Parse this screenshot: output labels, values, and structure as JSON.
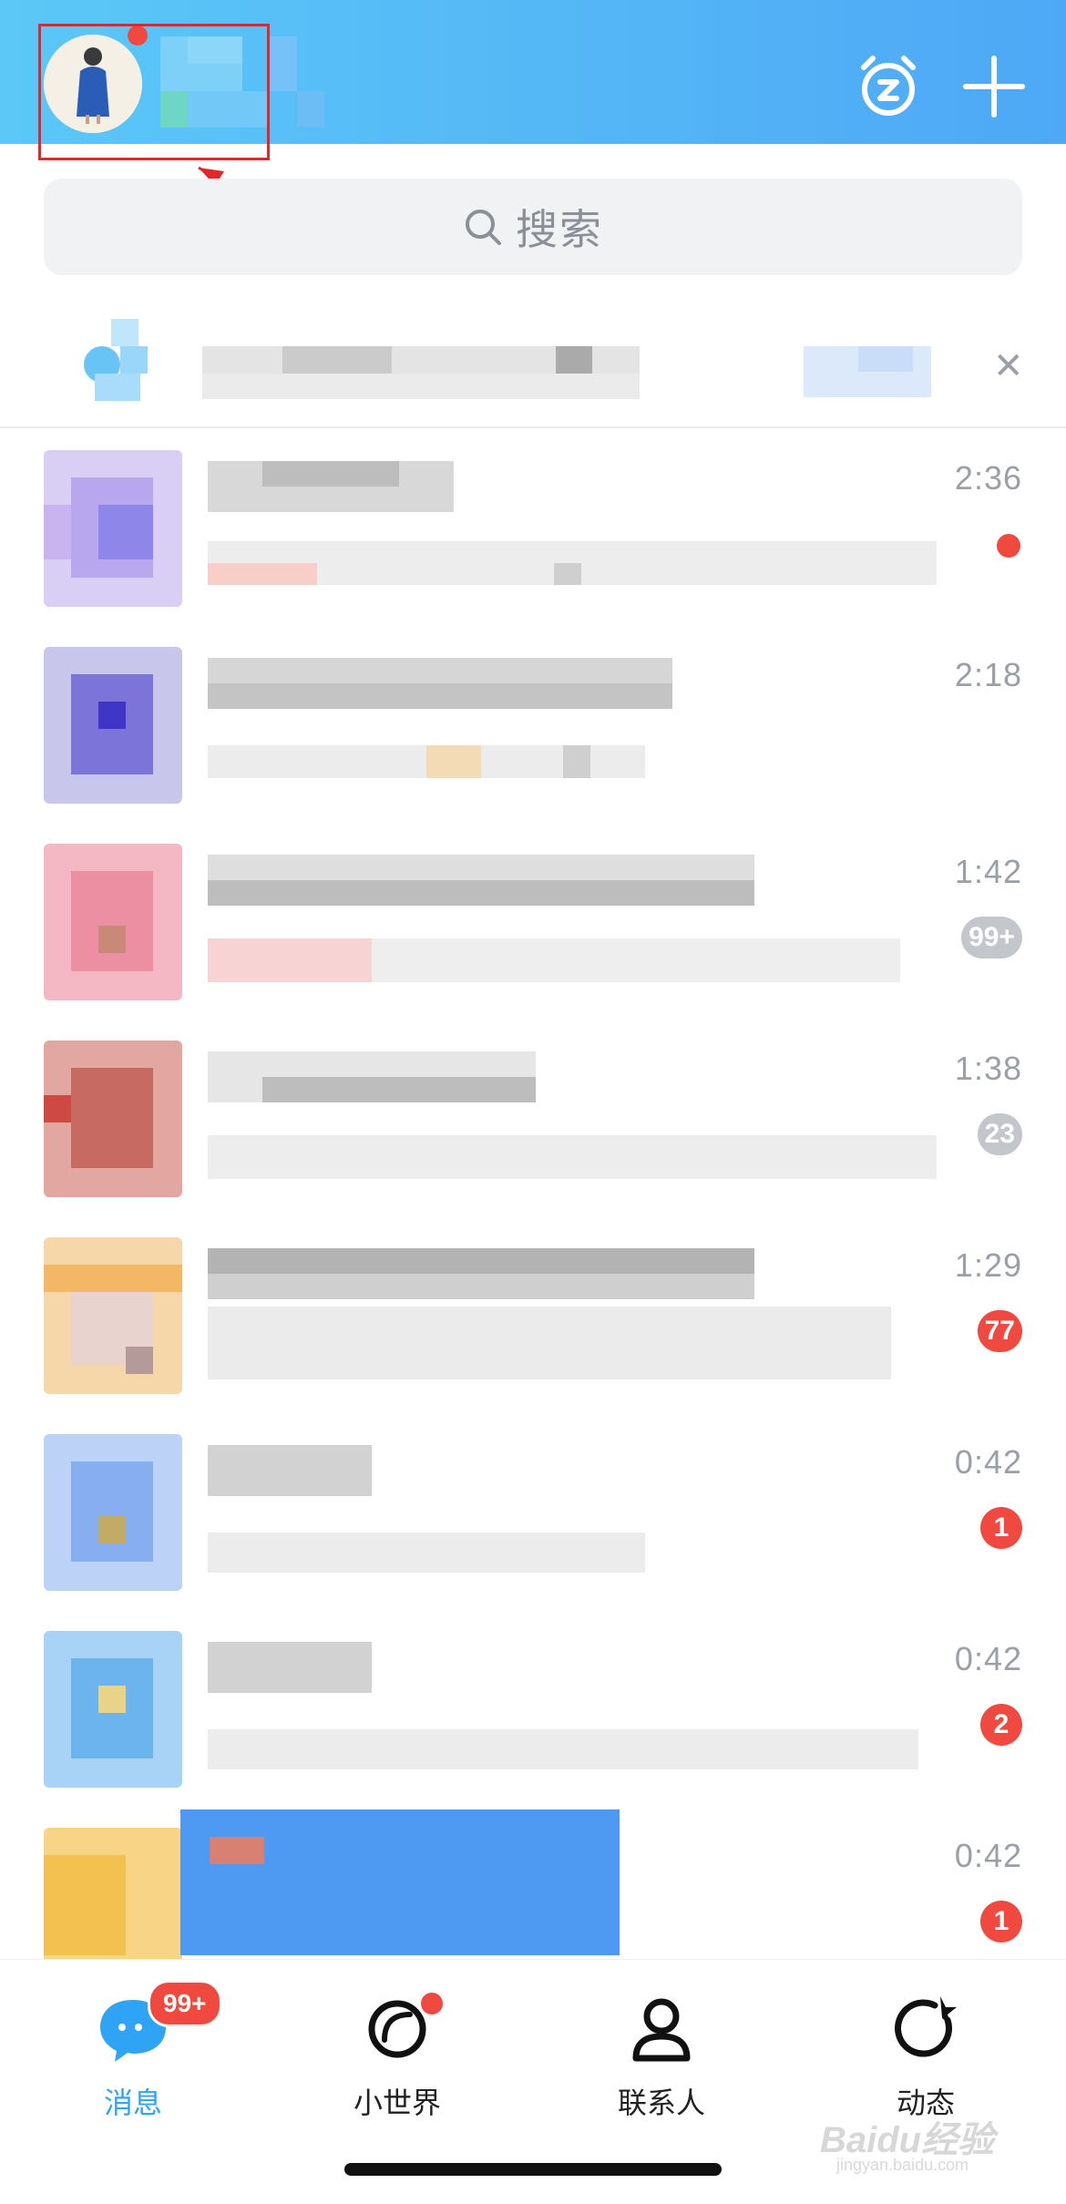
{
  "colors": {
    "header_gradient_start": "#5bc8f7",
    "header_gradient_end": "#4ea8f6",
    "badge_red": "#f0493f",
    "badge_grey": "#c3c6cb",
    "active_tab": "#2fa3f4",
    "annotation_red": "#e0272b"
  },
  "header": {
    "avatar_icon": "user-avatar",
    "right_icons": [
      "alarm-clock-icon",
      "plus-icon"
    ]
  },
  "search": {
    "placeholder": "搜索",
    "icon": "search-icon"
  },
  "notice": {
    "close_icon": "close-icon"
  },
  "conversations": [
    {
      "time": "2:36",
      "badge": "",
      "badge_style": "dot"
    },
    {
      "time": "2:18",
      "badge": "",
      "badge_style": "none"
    },
    {
      "time": "1:42",
      "badge": "99+",
      "badge_style": "grey"
    },
    {
      "time": "1:38",
      "badge": "23",
      "badge_style": "grey"
    },
    {
      "time": "1:29",
      "badge": "77",
      "badge_style": "red"
    },
    {
      "time": "0:42",
      "badge": "1",
      "badge_style": "red"
    },
    {
      "time": "0:42",
      "badge": "2",
      "badge_style": "red"
    },
    {
      "time": "0:42",
      "badge": "1",
      "badge_style": "red"
    }
  ],
  "bottom_nav": {
    "items": [
      {
        "label": "消息",
        "icon": "message-bubble-icon",
        "badge": "99+",
        "active": true
      },
      {
        "label": "小世界",
        "icon": "small-world-icon",
        "badge": "",
        "active": false
      },
      {
        "label": "联系人",
        "icon": "contacts-icon",
        "badge": "",
        "active": false
      },
      {
        "label": "动态",
        "icon": "feed-refresh-icon",
        "badge": "",
        "active": false
      }
    ]
  },
  "watermark": {
    "brand": "Baidu经验",
    "url": "jingyan.baidu.com"
  }
}
